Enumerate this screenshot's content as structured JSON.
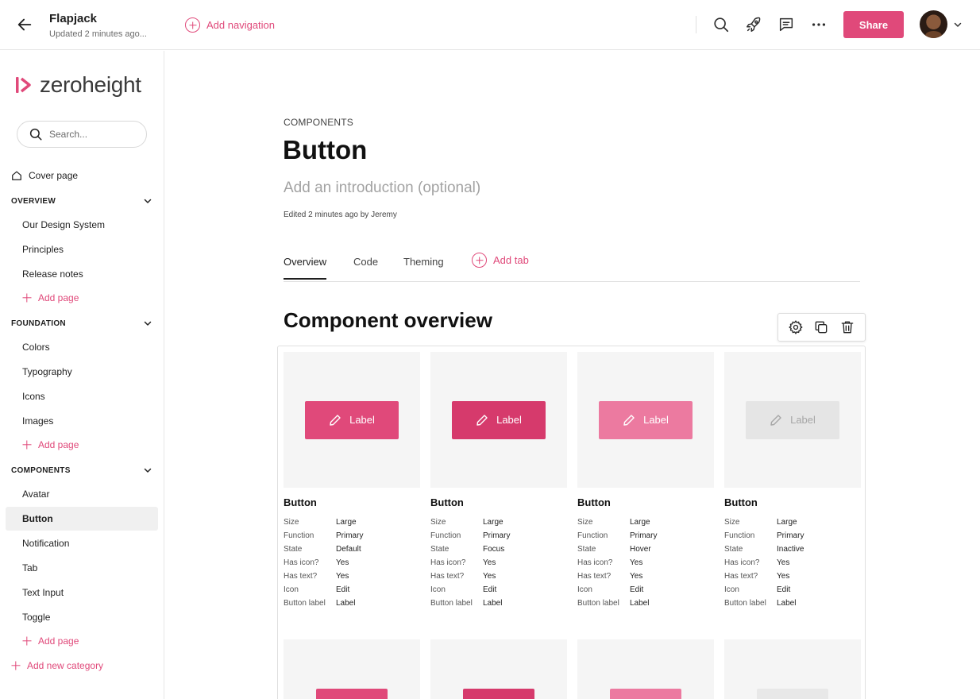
{
  "topbar": {
    "project_title": "Flapjack",
    "project_subtitle": "Updated 2 minutes ago...",
    "add_navigation_label": "Add navigation",
    "share_label": "Share"
  },
  "sidebar": {
    "logo_text": "zeroheight",
    "search_placeholder": "Search...",
    "cover_page_label": "Cover page",
    "sections": {
      "overview": {
        "title": "OVERVIEW",
        "items": [
          "Our Design System",
          "Principles",
          "Release notes"
        ],
        "add_page": "Add page"
      },
      "foundation": {
        "title": "FOUNDATION",
        "items": [
          "Colors",
          "Typography",
          "Icons",
          "Images"
        ],
        "add_page": "Add page"
      },
      "components": {
        "title": "COMPONENTS",
        "items": [
          "Avatar",
          "Button",
          "Notification",
          "Tab",
          "Text Input",
          "Toggle"
        ],
        "active_item": "Button",
        "add_page": "Add page"
      }
    },
    "add_category_label": "Add new category"
  },
  "main": {
    "breadcrumb": "COMPONENTS",
    "title": "Button",
    "intro_placeholder": "Add an introduction (optional)",
    "edited_text": "Edited 2 minutes ago by Jeremy",
    "tabs": [
      "Overview",
      "Code",
      "Theming"
    ],
    "active_tab": "Overview",
    "add_tab_label": "Add tab",
    "section_title": "Component overview"
  },
  "colors": {
    "accent": "#e0497a",
    "button_default": "#e0497a",
    "button_focus": "#d63a6c",
    "button_hover": "#ec7aa0",
    "button_inactive": "#e5e5e5",
    "button_inactive_text": "#a6a6a6"
  },
  "cards": [
    {
      "name": "Button",
      "demo_label": "Label",
      "demo_icon": "pencil-icon",
      "props": [
        {
          "key": "Size",
          "value": "Large"
        },
        {
          "key": "Function",
          "value": "Primary"
        },
        {
          "key": "State",
          "value": "Default"
        },
        {
          "key": "Has icon?",
          "value": "Yes"
        },
        {
          "key": "Has text?",
          "value": "Yes"
        },
        {
          "key": "Icon",
          "value": "Edit"
        },
        {
          "key": "Button label",
          "value": "Label"
        }
      ]
    },
    {
      "name": "Button",
      "demo_label": "Label",
      "demo_icon": "pencil-icon",
      "props": [
        {
          "key": "Size",
          "value": "Large"
        },
        {
          "key": "Function",
          "value": "Primary"
        },
        {
          "key": "State",
          "value": "Focus"
        },
        {
          "key": "Has icon?",
          "value": "Yes"
        },
        {
          "key": "Has text?",
          "value": "Yes"
        },
        {
          "key": "Icon",
          "value": "Edit"
        },
        {
          "key": "Button label",
          "value": "Label"
        }
      ]
    },
    {
      "name": "Button",
      "demo_label": "Label",
      "demo_icon": "pencil-icon",
      "props": [
        {
          "key": "Size",
          "value": "Large"
        },
        {
          "key": "Function",
          "value": "Primary"
        },
        {
          "key": "State",
          "value": "Hover"
        },
        {
          "key": "Has icon?",
          "value": "Yes"
        },
        {
          "key": "Has text?",
          "value": "Yes"
        },
        {
          "key": "Icon",
          "value": "Edit"
        },
        {
          "key": "Button label",
          "value": "Label"
        }
      ]
    },
    {
      "name": "Button",
      "demo_label": "Label",
      "demo_icon": "pencil-icon",
      "props": [
        {
          "key": "Size",
          "value": "Large"
        },
        {
          "key": "Function",
          "value": "Primary"
        },
        {
          "key": "State",
          "value": "Inactive"
        },
        {
          "key": "Has icon?",
          "value": "Yes"
        },
        {
          "key": "Has text?",
          "value": "Yes"
        },
        {
          "key": "Icon",
          "value": "Edit"
        },
        {
          "key": "Button label",
          "value": "Label"
        }
      ]
    }
  ],
  "icons": {
    "back": "arrow-left-icon",
    "search": "search-icon",
    "publish": "rocket-icon",
    "comments": "comment-icon",
    "more": "more-horizontal-icon",
    "settings": "gear-icon",
    "duplicate": "copy-icon",
    "delete": "trash-icon"
  }
}
